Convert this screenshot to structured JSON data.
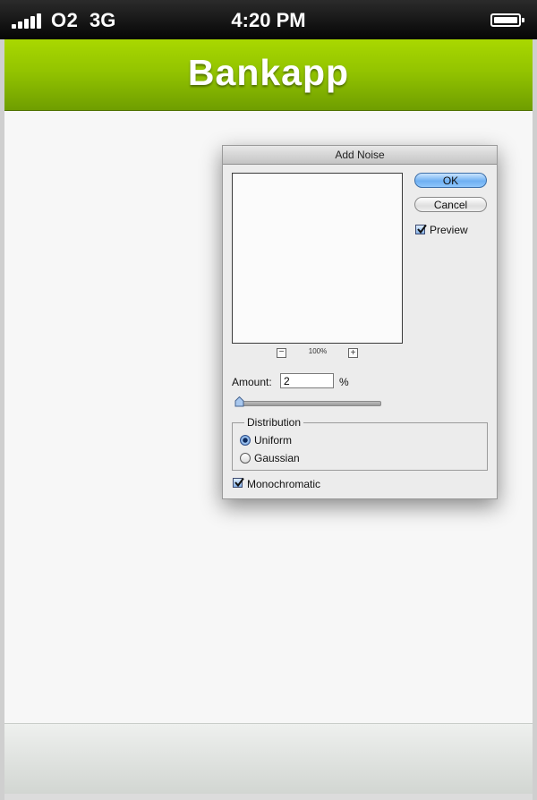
{
  "status_bar": {
    "carrier": "O2",
    "network": "3G",
    "time": "4:20 PM"
  },
  "nav": {
    "title": "Bankapp"
  },
  "dialog": {
    "title": "Add Noise",
    "ok_label": "OK",
    "cancel_label": "Cancel",
    "preview_label": "Preview",
    "preview_checked": true,
    "zoom_level": "100%",
    "amount_label": "Amount:",
    "amount_value": "2",
    "amount_unit": "%",
    "amount_slider_fraction": 0.02,
    "distribution_label": "Distribution",
    "distribution_options": [
      "Uniform",
      "Gaussian"
    ],
    "distribution_selected": "Uniform",
    "monochromatic_label": "Monochromatic",
    "monochromatic_checked": true
  },
  "colors": {
    "nav_green": "#93c400",
    "status_black": "#050505",
    "ok_blue": "#6fb0f2"
  }
}
